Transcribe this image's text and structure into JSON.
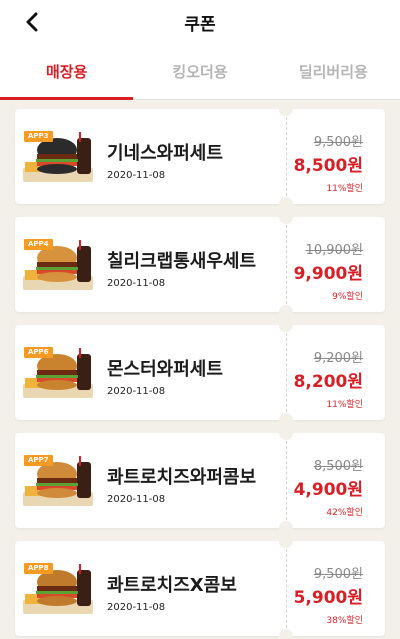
{
  "header": {
    "title": "쿠폰",
    "back_icon": "chevron-left-icon"
  },
  "tabs": [
    {
      "label": "매장용",
      "active": true
    },
    {
      "label": "킹오더용",
      "active": false
    },
    {
      "label": "딜리버리용",
      "active": false
    }
  ],
  "coupons": [
    {
      "badge": "APP3",
      "name": "기네스와퍼세트",
      "date": "2020-11-08",
      "old_price": "9,500원",
      "new_price": "8,500원",
      "discount": "11%할인",
      "bun": "#2b2b2b"
    },
    {
      "badge": "APP4",
      "name": "칠리크랩통새우세트",
      "date": "2020-11-08",
      "old_price": "10,900원",
      "new_price": "9,900원",
      "discount": "9%할인",
      "bun": "#d7923e"
    },
    {
      "badge": "APP6",
      "name": "몬스터와퍼세트",
      "date": "2020-11-08",
      "old_price": "9,200원",
      "new_price": "8,200원",
      "discount": "11%할인",
      "bun": "#c9832f"
    },
    {
      "badge": "APP7",
      "name": "콰트로치즈와퍼콤보",
      "date": "2020-11-08",
      "old_price": "8,500원",
      "new_price": "4,900원",
      "discount": "42%할인",
      "bun": "#cf8a3a"
    },
    {
      "badge": "APP8",
      "name": "콰트로치즈X콤보",
      "date": "2020-11-08",
      "old_price": "9,500원",
      "new_price": "5,900원",
      "discount": "38%할인",
      "bun": "#c07a2c"
    }
  ],
  "colors": {
    "accent": "#d91f26",
    "badge": "#f59a23",
    "background": "#f3efe9"
  }
}
